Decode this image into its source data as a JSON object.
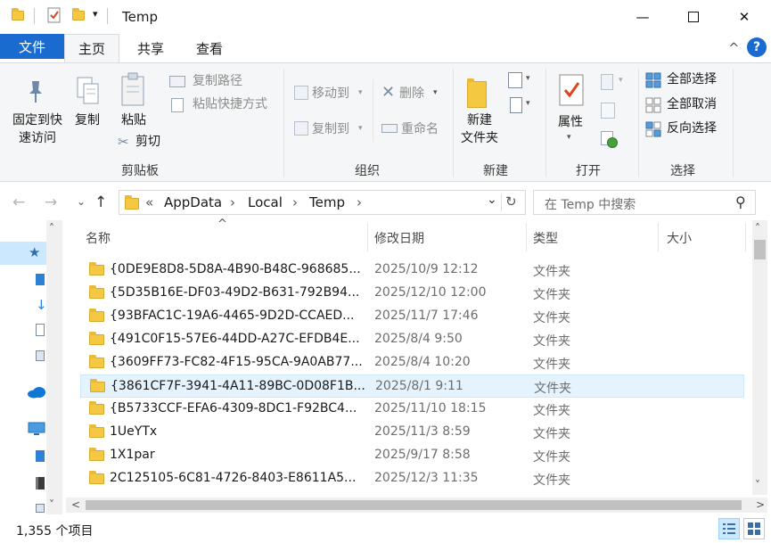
{
  "window": {
    "title": "Temp",
    "minimize_glyph": "—",
    "maximize_glyph": "☐",
    "close_glyph": "✕"
  },
  "quick_access": {
    "dropdown_glyph": "▾"
  },
  "tabs": {
    "file": "文件",
    "home": "主页",
    "share": "共享",
    "view": "查看",
    "collapse_glyph": "^",
    "help_glyph": "?"
  },
  "ribbon": {
    "clipboard": {
      "group": "剪贴板",
      "pin": "固定到快\n速访问",
      "copy": "复制",
      "paste": "粘贴",
      "copy_path": "复制路径",
      "paste_shortcut": "粘贴快捷方式",
      "cut": "剪切"
    },
    "organize": {
      "group": "组织",
      "move_to": "移动到",
      "copy_to": "复制到",
      "delete": "删除",
      "rename": "重命名"
    },
    "new": {
      "group": "新建",
      "new_folder": "新建\n文件夹"
    },
    "open": {
      "group": "打开",
      "properties": "属性"
    },
    "select": {
      "group": "选择",
      "select_all": "全部选择",
      "select_none": "全部取消",
      "invert": "反向选择"
    }
  },
  "address": {
    "back": "←",
    "forward": "→",
    "recent": "⌄",
    "up": "↑",
    "prefix": "«",
    "crumbs": [
      "AppData",
      "Local",
      "Temp"
    ],
    "sep": "›",
    "refresh": "↻",
    "dropdown": "⌄",
    "search_placeholder": "在 Temp 中搜索",
    "search_glyph": "⚲"
  },
  "columns": {
    "sort_glyph": "^",
    "name": "名称",
    "date": "修改日期",
    "type": "类型",
    "size": "大小"
  },
  "files": [
    {
      "name": "{0DE9E8D8-5D8A-4B90-B48C-968685...",
      "date": "2025/10/9 12:12",
      "type": "文件夹"
    },
    {
      "name": "{5D35B16E-DF03-49D2-B631-792B94...",
      "date": "2025/12/10 12:00",
      "type": "文件夹"
    },
    {
      "name": "{93BFAC1C-19A6-4465-9D2D-CCAED...",
      "date": "2025/11/7 17:46",
      "type": "文件夹"
    },
    {
      "name": "{491C0F15-57E6-44DD-A27C-EFDB4E...",
      "date": "2025/8/4 9:50",
      "type": "文件夹"
    },
    {
      "name": "{3609FF73-FC82-4F15-95CA-9A0AB77...",
      "date": "2025/8/4 10:20",
      "type": "文件夹"
    },
    {
      "name": "{3861CF7F-3941-4A11-89BC-0D08F1B...",
      "date": "2025/8/1 9:11",
      "type": "文件夹"
    },
    {
      "name": "{B5733CCF-EFA6-4309-8DC1-F92BC4...",
      "date": "2025/11/10 18:15",
      "type": "文件夹"
    },
    {
      "name": "1UeYTx",
      "date": "2025/11/3 8:59",
      "type": "文件夹"
    },
    {
      "name": "1X1par",
      "date": "2025/9/17 8:58",
      "type": "文件夹"
    },
    {
      "name": "2C125105-6C81-4726-8403-E8611A5...",
      "date": "2025/12/3 11:35",
      "type": "文件夹"
    }
  ],
  "selected_index": 5,
  "scroll": {
    "up": "˄",
    "down": "˅",
    "left": "<",
    "right": ">"
  },
  "status": {
    "item_count": "1,355 个项目"
  },
  "colors": {
    "accent": "#1a6bd0",
    "folder": "#f5c842",
    "selection": "#e5f3ff"
  }
}
